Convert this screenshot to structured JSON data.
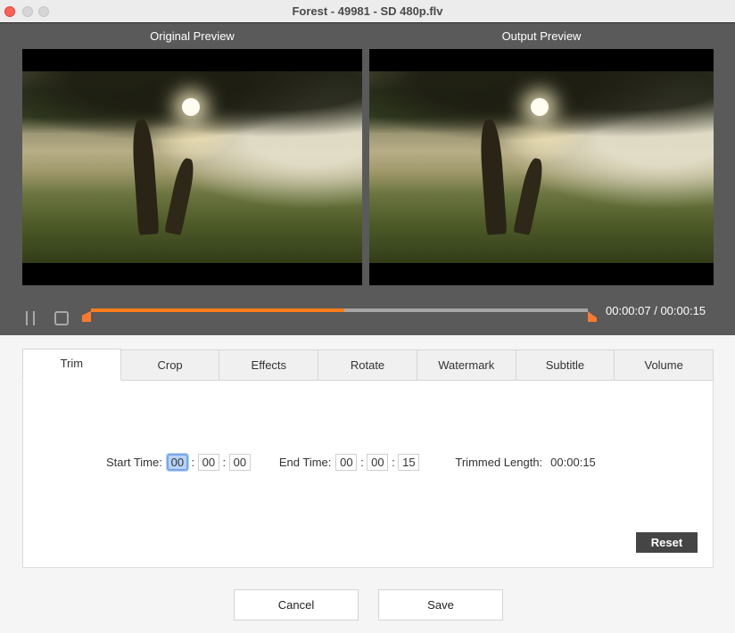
{
  "window": {
    "title": "Forest - 49981 - SD 480p.flv",
    "controls": [
      "close",
      "minimize",
      "maximize"
    ]
  },
  "preview": {
    "original_label": "Original Preview",
    "output_label": "Output  Preview",
    "video_description": "misty forest with sun shining through tree"
  },
  "playback": {
    "pause_icon": "pause-icon",
    "stop_icon": "stop-icon",
    "current_time": "00:00:07",
    "total_time": "00:00:15",
    "time_readout": "00:00:07 / 00:00:15",
    "progress_fraction": 0.51,
    "accent_color": "#ff7c1a"
  },
  "tabs": [
    {
      "label": "Trim",
      "active": true
    },
    {
      "label": "Crop",
      "active": false
    },
    {
      "label": "Effects",
      "active": false
    },
    {
      "label": "Rotate",
      "active": false
    },
    {
      "label": "Watermark",
      "active": false
    },
    {
      "label": "Subtitle",
      "active": false
    },
    {
      "label": "Volume",
      "active": false
    }
  ],
  "trim": {
    "start_label": "Start Time:",
    "start": {
      "hh": "00",
      "mm": "00",
      "ss": "00"
    },
    "end_label": "End Time:",
    "end": {
      "hh": "00",
      "mm": "00",
      "ss": "15"
    },
    "separator": ":",
    "length_label": "Trimmed Length:",
    "length_value": "00:00:15",
    "reset_label": "Reset"
  },
  "footer": {
    "cancel_label": "Cancel",
    "save_label": "Save"
  }
}
